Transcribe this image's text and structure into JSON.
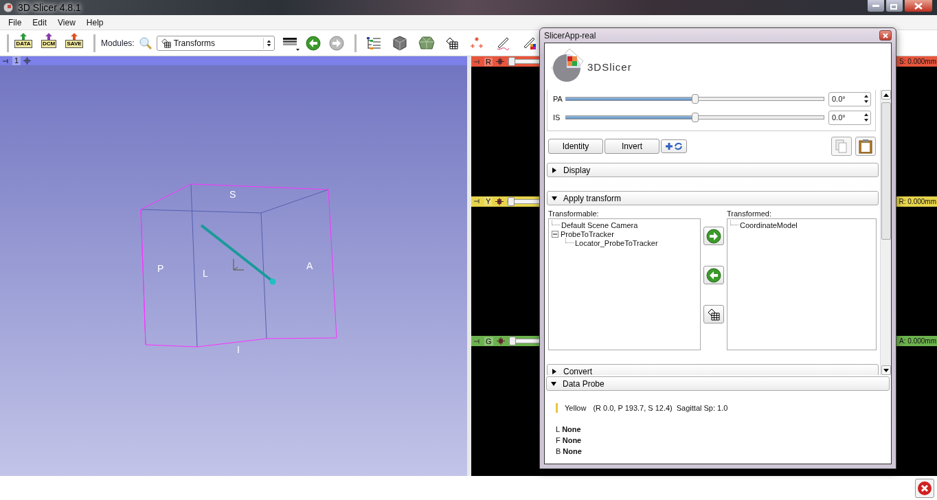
{
  "app": {
    "title": "3D Slicer 4.8.1"
  },
  "menu": [
    "File",
    "Edit",
    "View",
    "Help"
  ],
  "toolbar": {
    "data_buttons": [
      "DATA",
      "DCM",
      "SAVE"
    ],
    "modules_label": "Modules:",
    "module": "Transforms"
  },
  "view_3d": {
    "number": "1",
    "labels": [
      "S",
      "P",
      "L",
      "A",
      "I"
    ]
  },
  "slice_views": [
    {
      "letter": "R",
      "color": "#e8553d",
      "offset": "S: 0.000mm",
      "level": 0
    },
    {
      "letter": "Y",
      "color": "#e6d44c",
      "offset": "R: 0.000mm",
      "level": 0
    },
    {
      "letter": "G",
      "color": "#6cb24e",
      "offset": "A: 0.000mm",
      "level": 0
    }
  ],
  "dialog": {
    "title": "SlicerApp-real",
    "logo": "3DSlicer",
    "rotation": [
      {
        "axis": "PA",
        "level": 0.5,
        "value": "0.0°"
      },
      {
        "axis": "IS",
        "level": 0.5,
        "value": "0.0°"
      }
    ],
    "buttons": [
      "Identity",
      "Invert"
    ],
    "sections": [
      {
        "kind": "empty",
        "title": "Display",
        "expanded": false
      },
      {
        "kind": "apply_transform",
        "title": "Apply transform",
        "expanded": true,
        "transformable_label": "Transformable:",
        "transformed_label": "Transformed:",
        "transformable": [
          {
            "label": "Default Scene Camera"
          },
          {
            "label": "ProbeToTracker",
            "expanded": true,
            "children": [
              {
                "label": "Locator_ProbeToTracker"
              }
            ]
          }
        ],
        "transformed": [
          {
            "label": "CoordinateModel"
          }
        ]
      },
      {
        "kind": "empty",
        "title": "Convert",
        "expanded": false
      }
    ],
    "data_probe": {
      "title": "Data Probe",
      "expanded": true,
      "view": "Yellow",
      "color": "#e8c840",
      "position": "(R 0.0, P 193.7, S 12.4)",
      "spacing": "Sagittal Sp: 1.0",
      "layers": [
        {
          "letter": "L",
          "value": "None"
        },
        {
          "letter": "F",
          "value": "None"
        },
        {
          "letter": "B",
          "value": "None"
        }
      ]
    }
  }
}
